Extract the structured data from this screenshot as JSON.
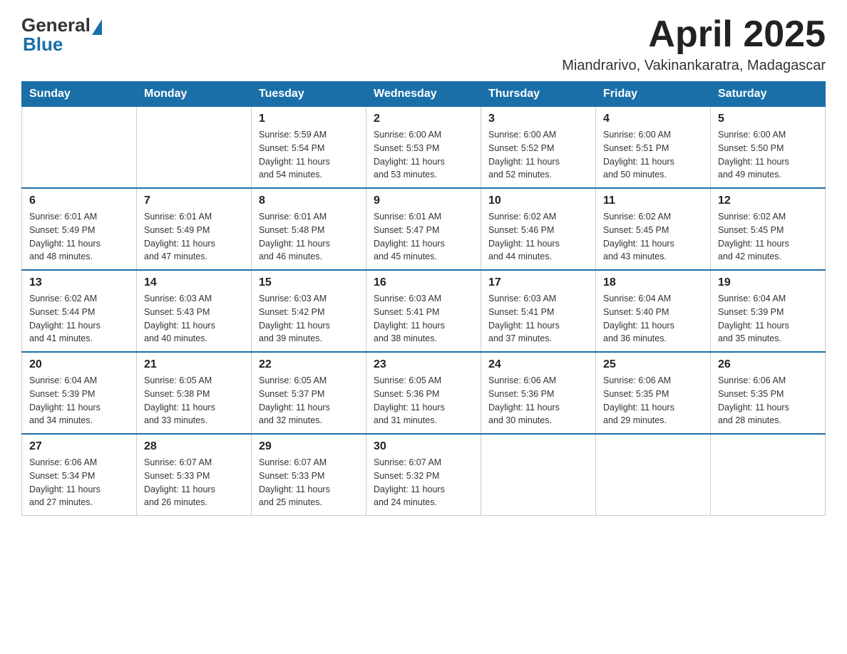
{
  "header": {
    "logo_general": "General",
    "logo_blue": "Blue",
    "month_year": "April 2025",
    "location": "Miandrarivo, Vakinankaratra, Madagascar"
  },
  "weekdays": [
    "Sunday",
    "Monday",
    "Tuesday",
    "Wednesday",
    "Thursday",
    "Friday",
    "Saturday"
  ],
  "weeks": [
    [
      {
        "day": "",
        "info": ""
      },
      {
        "day": "",
        "info": ""
      },
      {
        "day": "1",
        "info": "Sunrise: 5:59 AM\nSunset: 5:54 PM\nDaylight: 11 hours\nand 54 minutes."
      },
      {
        "day": "2",
        "info": "Sunrise: 6:00 AM\nSunset: 5:53 PM\nDaylight: 11 hours\nand 53 minutes."
      },
      {
        "day": "3",
        "info": "Sunrise: 6:00 AM\nSunset: 5:52 PM\nDaylight: 11 hours\nand 52 minutes."
      },
      {
        "day": "4",
        "info": "Sunrise: 6:00 AM\nSunset: 5:51 PM\nDaylight: 11 hours\nand 50 minutes."
      },
      {
        "day": "5",
        "info": "Sunrise: 6:00 AM\nSunset: 5:50 PM\nDaylight: 11 hours\nand 49 minutes."
      }
    ],
    [
      {
        "day": "6",
        "info": "Sunrise: 6:01 AM\nSunset: 5:49 PM\nDaylight: 11 hours\nand 48 minutes."
      },
      {
        "day": "7",
        "info": "Sunrise: 6:01 AM\nSunset: 5:49 PM\nDaylight: 11 hours\nand 47 minutes."
      },
      {
        "day": "8",
        "info": "Sunrise: 6:01 AM\nSunset: 5:48 PM\nDaylight: 11 hours\nand 46 minutes."
      },
      {
        "day": "9",
        "info": "Sunrise: 6:01 AM\nSunset: 5:47 PM\nDaylight: 11 hours\nand 45 minutes."
      },
      {
        "day": "10",
        "info": "Sunrise: 6:02 AM\nSunset: 5:46 PM\nDaylight: 11 hours\nand 44 minutes."
      },
      {
        "day": "11",
        "info": "Sunrise: 6:02 AM\nSunset: 5:45 PM\nDaylight: 11 hours\nand 43 minutes."
      },
      {
        "day": "12",
        "info": "Sunrise: 6:02 AM\nSunset: 5:45 PM\nDaylight: 11 hours\nand 42 minutes."
      }
    ],
    [
      {
        "day": "13",
        "info": "Sunrise: 6:02 AM\nSunset: 5:44 PM\nDaylight: 11 hours\nand 41 minutes."
      },
      {
        "day": "14",
        "info": "Sunrise: 6:03 AM\nSunset: 5:43 PM\nDaylight: 11 hours\nand 40 minutes."
      },
      {
        "day": "15",
        "info": "Sunrise: 6:03 AM\nSunset: 5:42 PM\nDaylight: 11 hours\nand 39 minutes."
      },
      {
        "day": "16",
        "info": "Sunrise: 6:03 AM\nSunset: 5:41 PM\nDaylight: 11 hours\nand 38 minutes."
      },
      {
        "day": "17",
        "info": "Sunrise: 6:03 AM\nSunset: 5:41 PM\nDaylight: 11 hours\nand 37 minutes."
      },
      {
        "day": "18",
        "info": "Sunrise: 6:04 AM\nSunset: 5:40 PM\nDaylight: 11 hours\nand 36 minutes."
      },
      {
        "day": "19",
        "info": "Sunrise: 6:04 AM\nSunset: 5:39 PM\nDaylight: 11 hours\nand 35 minutes."
      }
    ],
    [
      {
        "day": "20",
        "info": "Sunrise: 6:04 AM\nSunset: 5:39 PM\nDaylight: 11 hours\nand 34 minutes."
      },
      {
        "day": "21",
        "info": "Sunrise: 6:05 AM\nSunset: 5:38 PM\nDaylight: 11 hours\nand 33 minutes."
      },
      {
        "day": "22",
        "info": "Sunrise: 6:05 AM\nSunset: 5:37 PM\nDaylight: 11 hours\nand 32 minutes."
      },
      {
        "day": "23",
        "info": "Sunrise: 6:05 AM\nSunset: 5:36 PM\nDaylight: 11 hours\nand 31 minutes."
      },
      {
        "day": "24",
        "info": "Sunrise: 6:06 AM\nSunset: 5:36 PM\nDaylight: 11 hours\nand 30 minutes."
      },
      {
        "day": "25",
        "info": "Sunrise: 6:06 AM\nSunset: 5:35 PM\nDaylight: 11 hours\nand 29 minutes."
      },
      {
        "day": "26",
        "info": "Sunrise: 6:06 AM\nSunset: 5:35 PM\nDaylight: 11 hours\nand 28 minutes."
      }
    ],
    [
      {
        "day": "27",
        "info": "Sunrise: 6:06 AM\nSunset: 5:34 PM\nDaylight: 11 hours\nand 27 minutes."
      },
      {
        "day": "28",
        "info": "Sunrise: 6:07 AM\nSunset: 5:33 PM\nDaylight: 11 hours\nand 26 minutes."
      },
      {
        "day": "29",
        "info": "Sunrise: 6:07 AM\nSunset: 5:33 PM\nDaylight: 11 hours\nand 25 minutes."
      },
      {
        "day": "30",
        "info": "Sunrise: 6:07 AM\nSunset: 5:32 PM\nDaylight: 11 hours\nand 24 minutes."
      },
      {
        "day": "",
        "info": ""
      },
      {
        "day": "",
        "info": ""
      },
      {
        "day": "",
        "info": ""
      }
    ]
  ]
}
